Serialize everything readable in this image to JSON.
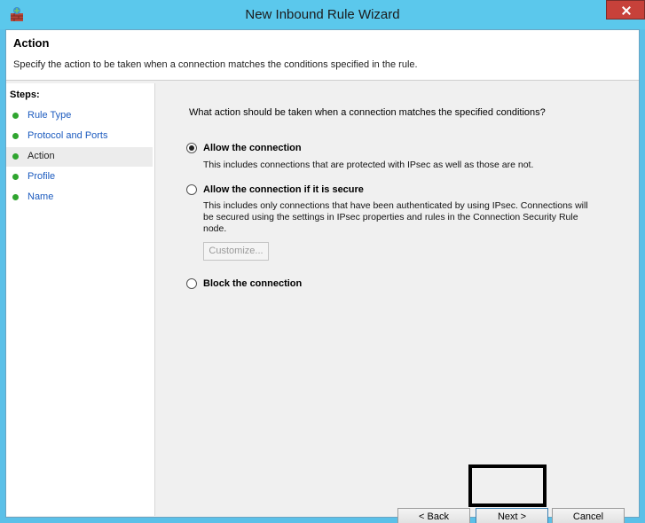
{
  "window": {
    "title": "New Inbound Rule Wizard"
  },
  "header": {
    "title": "Action",
    "description": "Specify the action to be taken when a connection matches the conditions specified in the rule."
  },
  "steps": {
    "label": "Steps:",
    "items": [
      {
        "label": "Rule Type",
        "current": false
      },
      {
        "label": "Protocol and Ports",
        "current": false
      },
      {
        "label": "Action",
        "current": true
      },
      {
        "label": "Profile",
        "current": false
      },
      {
        "label": "Name",
        "current": false
      }
    ]
  },
  "main": {
    "question": "What action should be taken when a connection matches the specified conditions?",
    "options": [
      {
        "label": "Allow the connection",
        "description": "This includes connections that are protected with IPsec as well as those are not.",
        "selected": true
      },
      {
        "label": "Allow the connection if it is secure",
        "description": "This includes only connections that have been authenticated by using IPsec.  Connections will be secured using the settings in IPsec properties and rules in the Connection Security Rule node.",
        "selected": false
      },
      {
        "label": "Block the connection",
        "description": "",
        "selected": false
      }
    ],
    "customize_label": "Customize..."
  },
  "footer": {
    "back_label": "< Back",
    "next_label": "Next >",
    "cancel_label": "Cancel"
  },
  "colors": {
    "titlebar": "#5bc8ec",
    "step_done": "#2fa52f",
    "close_button": "#c7413a"
  }
}
